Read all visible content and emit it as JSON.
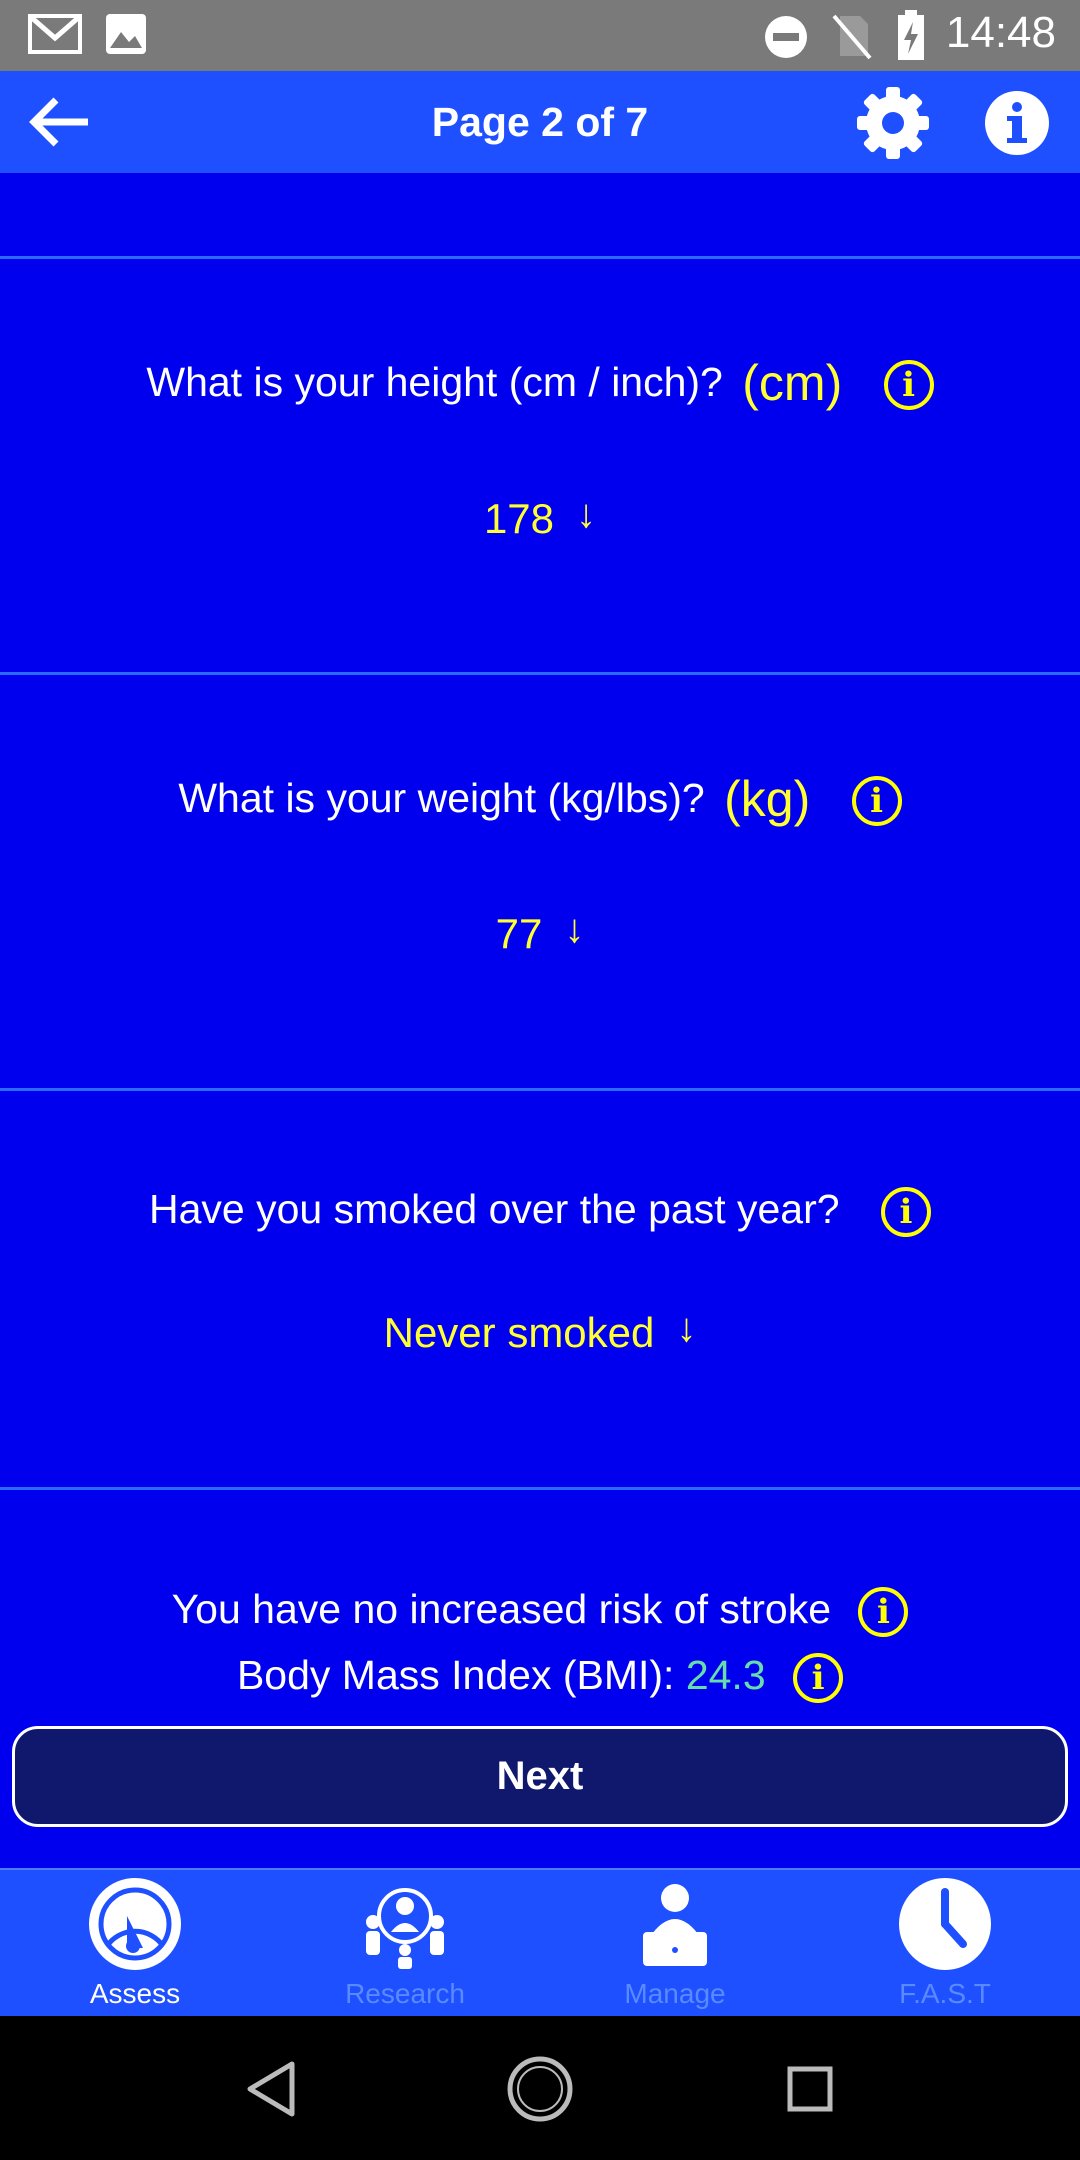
{
  "status_bar": {
    "time": "14:48",
    "icons": [
      "gmail-icon",
      "image-icon",
      "do-not-disturb-icon",
      "no-sim-icon",
      "battery-charging-icon"
    ]
  },
  "app_bar": {
    "title": "Page 2 of 7",
    "icons": [
      "back-arrow-icon",
      "settings-gear-icon",
      "info-icon"
    ]
  },
  "questions": {
    "height": {
      "label": "What is your height (cm / inch)?",
      "unit": "(cm)",
      "value": "178",
      "arrow": "↓"
    },
    "weight": {
      "label": "What is your weight (kg/lbs)?",
      "unit": "(kg)",
      "value": "77",
      "arrow": "↓"
    },
    "smoking": {
      "label": "Have you smoked over the past year?",
      "value": "Never smoked",
      "arrow": "↓"
    }
  },
  "result": {
    "risk_text": "You have no increased risk of stroke",
    "bmi_label": "Body Mass Index (BMI):",
    "bmi_value": "24.3"
  },
  "info_glyph": "i",
  "next_button": {
    "label": "Next"
  },
  "bottom_nav": {
    "items": [
      {
        "label": "Assess",
        "icon": "gauge-icon",
        "active": true
      },
      {
        "label": "Research",
        "icon": "people-group-icon",
        "active": false
      },
      {
        "label": "Manage",
        "icon": "person-laptop-icon",
        "active": false
      },
      {
        "label": "F.A.S.T",
        "icon": "clock-icon",
        "active": false
      }
    ]
  },
  "colors": {
    "background": "#0000ee",
    "app_bar": "#1e50ff",
    "accent_yellow": "#ffff33",
    "bmi_value": "#66ddaa",
    "next_button": "#10186e"
  }
}
